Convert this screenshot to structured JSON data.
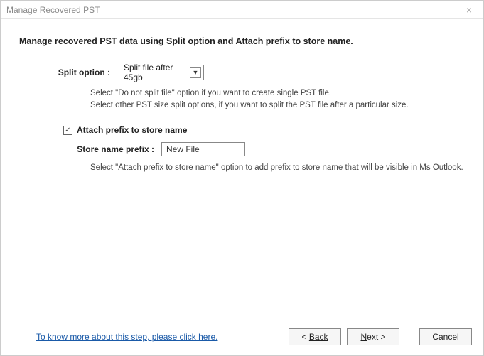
{
  "window": {
    "title": "Manage Recovered PST"
  },
  "heading": "Manage recovered PST data using Split option and Attach prefix to store name.",
  "split": {
    "label": "Split option :",
    "selected": "Split file after 45gb",
    "desc_line1": "Select \"Do not split file\" option if you want to create single PST file.",
    "desc_line2": "Select other PST size split options, if you want to split the PST file after a particular size."
  },
  "prefix": {
    "checked": true,
    "checkbox_label": "Attach prefix to store name",
    "label": "Store name prefix :",
    "value": "New File",
    "desc": "Select \"Attach prefix to store name\" option to add prefix to store name that will be visible in Ms Outlook."
  },
  "footer": {
    "help_link": "To know more about this step, please click here.",
    "back": "Back",
    "next": "Next >",
    "cancel": "Cancel"
  }
}
